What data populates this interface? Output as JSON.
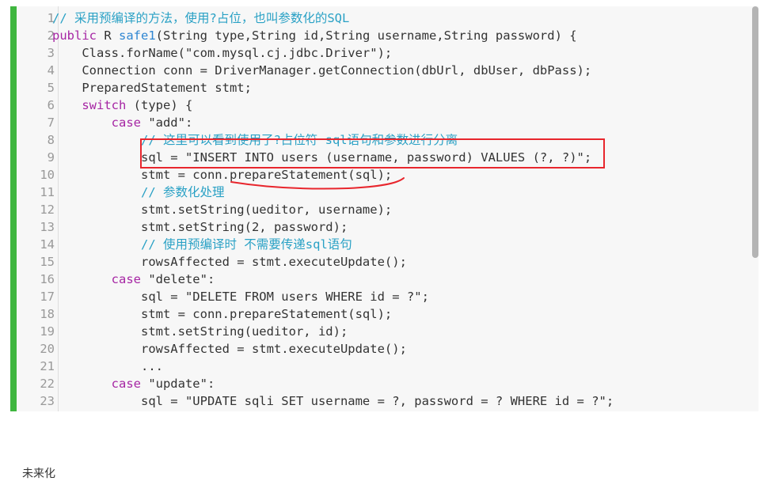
{
  "editor": {
    "lines": [
      {
        "num": "1",
        "text": "// 采用预编译的方法，使用?占位，也叫参数化的SQL"
      },
      {
        "num": "2",
        "text": "public R safe1(String type,String id,String username,String password) {"
      },
      {
        "num": "3",
        "text": "    Class.forName(\"com.mysql.cj.jdbc.Driver\");"
      },
      {
        "num": "4",
        "text": "    Connection conn = DriverManager.getConnection(dbUrl, dbUser, dbPass);"
      },
      {
        "num": "5",
        "text": "    PreparedStatement stmt;"
      },
      {
        "num": "6",
        "text": "    switch (type) {"
      },
      {
        "num": "7",
        "text": "        case \"add\":"
      },
      {
        "num": "8",
        "text": "            // 这里可以看到使用了?占位符 sql语句和参数进行分离"
      },
      {
        "num": "9",
        "text": "            sql = \"INSERT INTO users (username, password) VALUES (?, ?)\";"
      },
      {
        "num": "10",
        "text": "            stmt = conn.prepareStatement(sql);"
      },
      {
        "num": "11",
        "text": "            // 参数化处理"
      },
      {
        "num": "12",
        "text": "            stmt.setString(ueditor, username);"
      },
      {
        "num": "13",
        "text": "            stmt.setString(2, password);"
      },
      {
        "num": "14",
        "text": "            // 使用预编译时 不需要传递sql语句"
      },
      {
        "num": "15",
        "text": "            rowsAffected = stmt.executeUpdate();"
      },
      {
        "num": "16",
        "text": "        case \"delete\":"
      },
      {
        "num": "17",
        "text": "            sql = \"DELETE FROM users WHERE id = ?\";"
      },
      {
        "num": "18",
        "text": "            stmt = conn.prepareStatement(sql);"
      },
      {
        "num": "19",
        "text": "            stmt.setString(ueditor, id);"
      },
      {
        "num": "20",
        "text": "            rowsAffected = stmt.executeUpdate();"
      },
      {
        "num": "21",
        "text": "            ..."
      },
      {
        "num": "22",
        "text": "        case \"update\":"
      },
      {
        "num": "23",
        "text": "            sql = \"UPDATE sqli SET username = ?, password = ? WHERE id = ?\";"
      }
    ]
  },
  "bottom_text": "未来化",
  "colors": {
    "keyword": "#a626a4",
    "comment": "#2aa1c5",
    "function": "#2f86d2",
    "annotation_red": "#e8262d",
    "gutter_accent": "#3fb63f"
  }
}
